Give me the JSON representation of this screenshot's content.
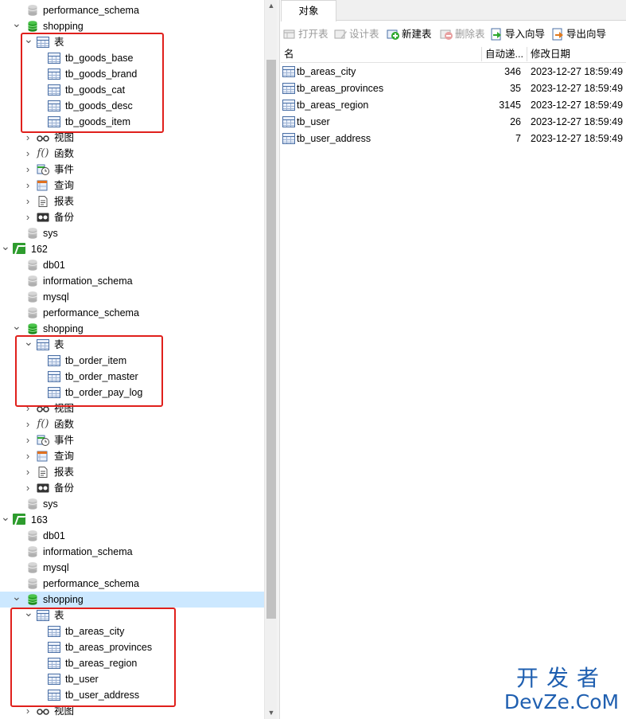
{
  "tree": {
    "rows": [
      {
        "label": "performance_schema",
        "type": "db",
        "level": 1,
        "arrow": ""
      },
      {
        "label": "shopping",
        "type": "db-open",
        "level": 1,
        "arrow": "open"
      },
      {
        "label": "表",
        "type": "tables",
        "level": 2,
        "arrow": "open"
      },
      {
        "label": "tb_goods_base",
        "type": "table",
        "level": 3,
        "arrow": ""
      },
      {
        "label": "tb_goods_brand",
        "type": "table",
        "level": 3,
        "arrow": ""
      },
      {
        "label": "tb_goods_cat",
        "type": "table",
        "level": 3,
        "arrow": ""
      },
      {
        "label": "tb_goods_desc",
        "type": "table",
        "level": 3,
        "arrow": ""
      },
      {
        "label": "tb_goods_item",
        "type": "table",
        "level": 3,
        "arrow": ""
      },
      {
        "label": "视图",
        "type": "views",
        "level": 2,
        "arrow": "closed"
      },
      {
        "label": "函数",
        "type": "functions",
        "level": 2,
        "arrow": "closed"
      },
      {
        "label": "事件",
        "type": "events",
        "level": 2,
        "arrow": "closed"
      },
      {
        "label": "查询",
        "type": "queries",
        "level": 2,
        "arrow": "closed"
      },
      {
        "label": "报表",
        "type": "reports",
        "level": 2,
        "arrow": "closed"
      },
      {
        "label": "备份",
        "type": "backups",
        "level": 2,
        "arrow": "closed"
      },
      {
        "label": "sys",
        "type": "db",
        "level": 1,
        "arrow": ""
      },
      {
        "label": "162",
        "type": "connection",
        "level": 0,
        "arrow": "open"
      },
      {
        "label": "db01",
        "type": "db",
        "level": 1,
        "arrow": ""
      },
      {
        "label": "information_schema",
        "type": "db",
        "level": 1,
        "arrow": ""
      },
      {
        "label": "mysql",
        "type": "db",
        "level": 1,
        "arrow": ""
      },
      {
        "label": "performance_schema",
        "type": "db",
        "level": 1,
        "arrow": ""
      },
      {
        "label": "shopping",
        "type": "db-open",
        "level": 1,
        "arrow": "open"
      },
      {
        "label": "表",
        "type": "tables",
        "level": 2,
        "arrow": "open"
      },
      {
        "label": "tb_order_item",
        "type": "table",
        "level": 3,
        "arrow": ""
      },
      {
        "label": "tb_order_master",
        "type": "table",
        "level": 3,
        "arrow": ""
      },
      {
        "label": "tb_order_pay_log",
        "type": "table",
        "level": 3,
        "arrow": ""
      },
      {
        "label": "视图",
        "type": "views",
        "level": 2,
        "arrow": "closed"
      },
      {
        "label": "函数",
        "type": "functions",
        "level": 2,
        "arrow": "closed"
      },
      {
        "label": "事件",
        "type": "events",
        "level": 2,
        "arrow": "closed"
      },
      {
        "label": "查询",
        "type": "queries",
        "level": 2,
        "arrow": "closed"
      },
      {
        "label": "报表",
        "type": "reports",
        "level": 2,
        "arrow": "closed"
      },
      {
        "label": "备份",
        "type": "backups",
        "level": 2,
        "arrow": "closed"
      },
      {
        "label": "sys",
        "type": "db",
        "level": 1,
        "arrow": ""
      },
      {
        "label": "163",
        "type": "connection",
        "level": 0,
        "arrow": "open"
      },
      {
        "label": "db01",
        "type": "db",
        "level": 1,
        "arrow": ""
      },
      {
        "label": "information_schema",
        "type": "db",
        "level": 1,
        "arrow": ""
      },
      {
        "label": "mysql",
        "type": "db",
        "level": 1,
        "arrow": ""
      },
      {
        "label": "performance_schema",
        "type": "db",
        "level": 1,
        "arrow": ""
      },
      {
        "label": "shopping",
        "type": "db-open",
        "level": 1,
        "arrow": "open",
        "selected": true
      },
      {
        "label": "表",
        "type": "tables",
        "level": 2,
        "arrow": "open"
      },
      {
        "label": "tb_areas_city",
        "type": "table",
        "level": 3,
        "arrow": ""
      },
      {
        "label": "tb_areas_provinces",
        "type": "table",
        "level": 3,
        "arrow": ""
      },
      {
        "label": "tb_areas_region",
        "type": "table",
        "level": 3,
        "arrow": ""
      },
      {
        "label": "tb_user",
        "type": "table",
        "level": 3,
        "arrow": ""
      },
      {
        "label": "tb_user_address",
        "type": "table",
        "level": 3,
        "arrow": ""
      },
      {
        "label": "视图",
        "type": "views",
        "level": 2,
        "arrow": "closed"
      }
    ]
  },
  "tabs": {
    "objects": "对象"
  },
  "toolbar": {
    "open_table": "打开表",
    "design_table": "设计表",
    "new_table": "新建表",
    "delete_table": "删除表",
    "import_wizard": "导入向导",
    "export_wizard": "导出向导"
  },
  "grid": {
    "headers": {
      "name": "名",
      "auto_increment": "自动递...",
      "modified": "修改日期"
    },
    "rows": [
      {
        "name": "tb_areas_city",
        "auto_increment": "346",
        "modified": "2023-12-27 18:59:49"
      },
      {
        "name": "tb_areas_provinces",
        "auto_increment": "35",
        "modified": "2023-12-27 18:59:49"
      },
      {
        "name": "tb_areas_region",
        "auto_increment": "3145",
        "modified": "2023-12-27 18:59:49"
      },
      {
        "name": "tb_user",
        "auto_increment": "26",
        "modified": "2023-12-27 18:59:49"
      },
      {
        "name": "tb_user_address",
        "auto_increment": "7",
        "modified": "2023-12-27 18:59:49"
      }
    ]
  },
  "watermark": {
    "line1": "开发者",
    "line2": "DevZe.CoM"
  },
  "colors": {
    "highlight_box": "#e0201c",
    "selection": "#cce8ff",
    "watermark": "#1f5fb0",
    "db_icon": "#2eaa2e"
  }
}
